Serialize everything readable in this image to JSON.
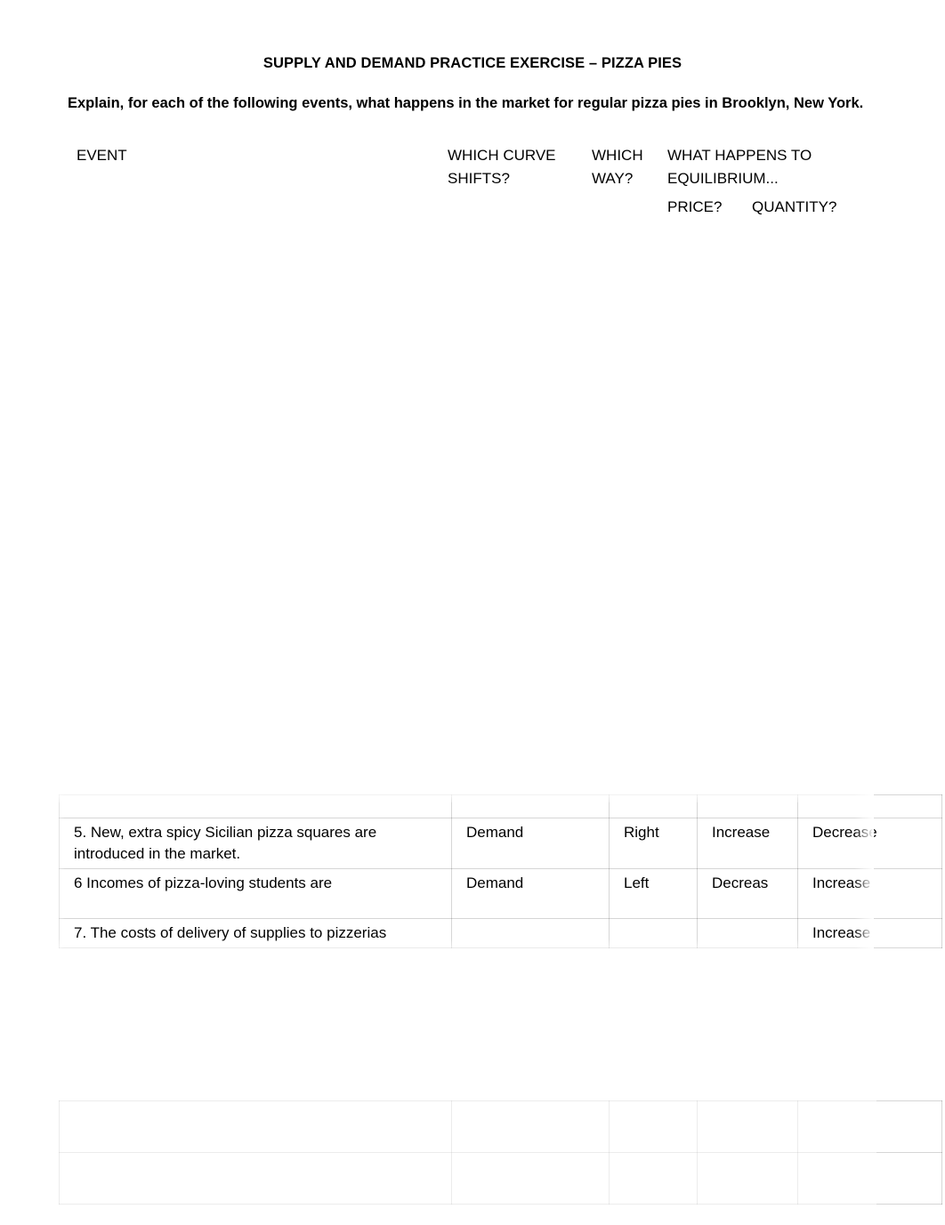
{
  "document": {
    "title": "SUPPLY AND DEMAND PRACTICE EXERCISE – PIZZA PIES",
    "instruction": "Explain, for each of the following events, what happens in the market for regular pizza pies in Brooklyn, New York."
  },
  "table_header": {
    "event": "EVENT",
    "which_curve_shifts": "WHICH CURVE\nSHIFTS?",
    "which_way": "WHICH\nWAY?",
    "what_happens_to_equilibrium": "WHAT HAPPENS TO\nEQUILIBRIUM...",
    "price": "PRICE?",
    "quantity": "QUANTITY?"
  },
  "table_main": {
    "rows": [
      {
        "event": "",
        "curve": "",
        "way": "",
        "price": "",
        "quantity": "",
        "legible": false
      },
      {
        "event": "5. New, extra spicy Sicilian pizza squares are introduced in the market.",
        "curve": "Demand",
        "way": "Right",
        "price": "Increase",
        "quantity": "Decrease",
        "legible": true
      },
      {
        "event": "6  Incomes of  pizza-loving students are",
        "curve": "Demand",
        "way": "Left",
        "price": "Decreas",
        "quantity": "Increase",
        "legible": true
      },
      {
        "event": "7. The costs of delivery of supplies to pizzerias",
        "curve": "",
        "way": "",
        "price": "",
        "quantity": "Increase",
        "legible": true
      }
    ]
  },
  "table_lower": {
    "rows": [
      {
        "event": "",
        "curve": "",
        "way": "",
        "price": "",
        "quantity": "",
        "legible": false
      },
      {
        "event": "",
        "curve": "",
        "way": "",
        "price": "",
        "quantity": "",
        "legible": false
      }
    ]
  }
}
